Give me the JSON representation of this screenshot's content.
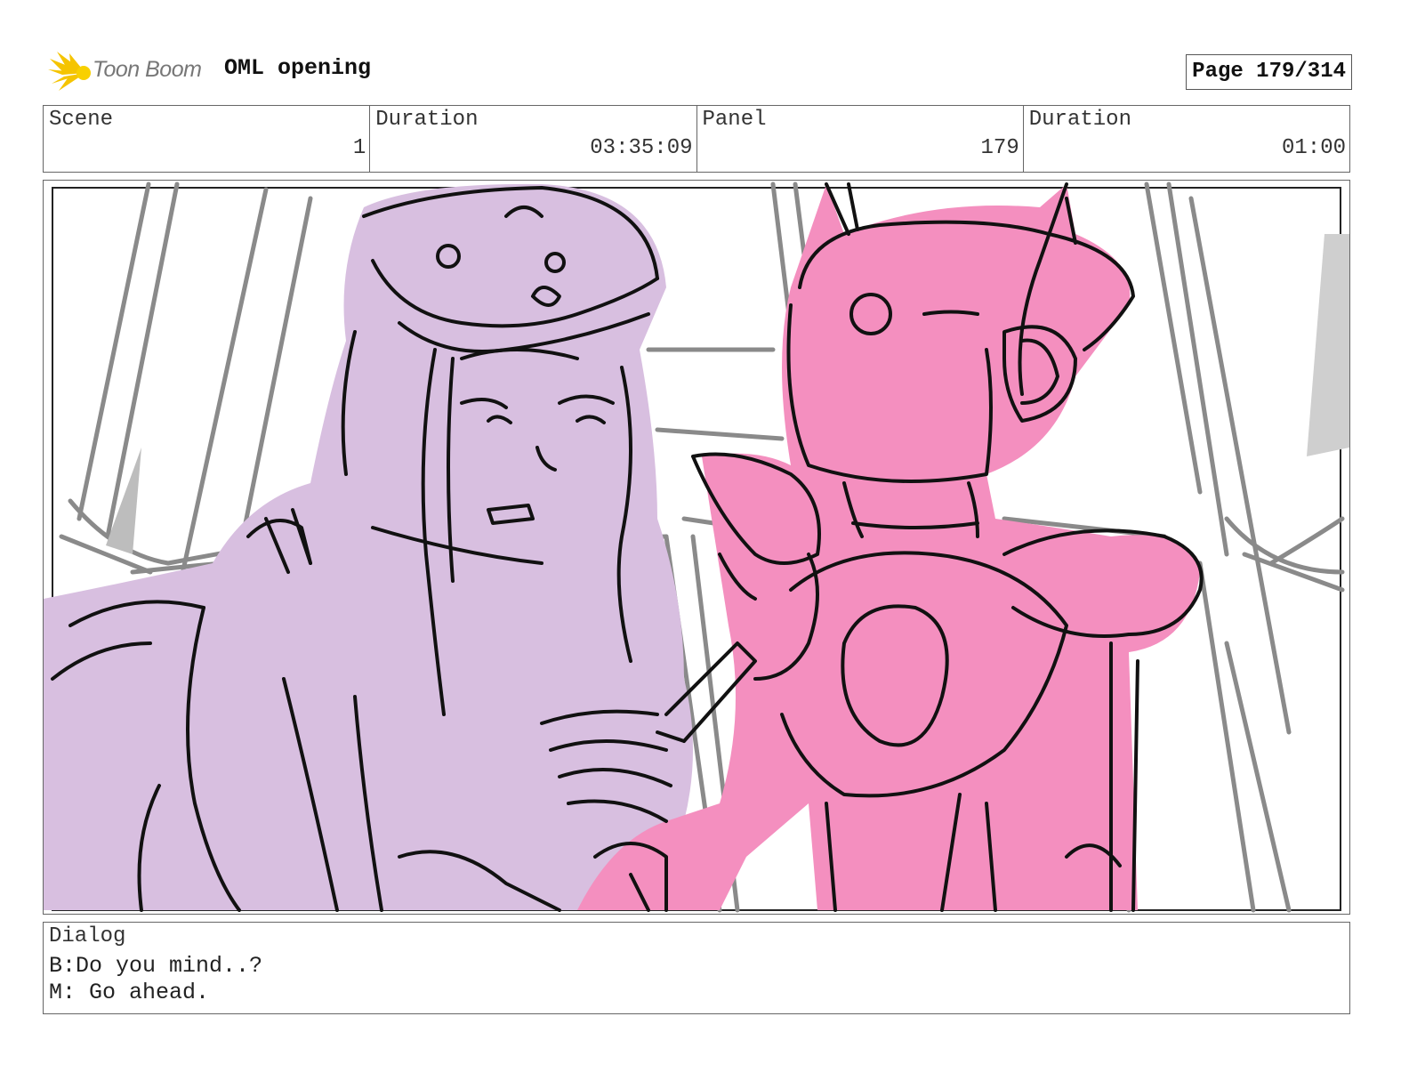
{
  "header": {
    "logo_text": "Toon Boom",
    "title": "OML opening",
    "page": "Page 179/314"
  },
  "info": {
    "scene_label": "Scene",
    "scene_value": "1",
    "duration_label": "Duration",
    "duration_value": "03:35:09",
    "panel_label": "Panel",
    "panel_value": "179",
    "panel_duration_label": "Duration",
    "panel_duration_value": "01:00"
  },
  "dialog": {
    "label": "Dialog",
    "lines": [
      "B:Do you mind..?",
      "M: Go ahead."
    ]
  },
  "colors": {
    "lilac": "#d8bfe0",
    "pink": "#f48fbf",
    "sketch_gray": "#8a8a8a"
  }
}
